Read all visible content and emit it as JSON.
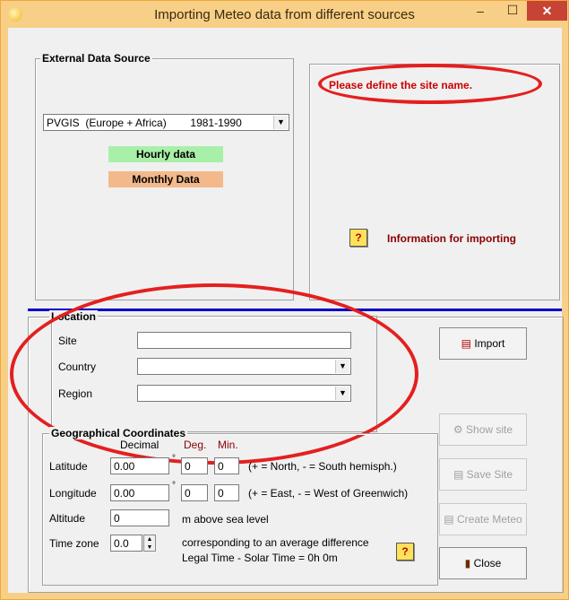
{
  "window": {
    "title": "Importing Meteo data from different sources",
    "minimize": "–",
    "maximize": "☐",
    "close": "✕"
  },
  "external_source": {
    "legend": "External Data Source",
    "source_selected": "PVGIS  (Europe + Africa)        1981-1990",
    "hourly_label": "Hourly data",
    "monthly_label": "Monthly Data"
  },
  "message": {
    "text": "Please define the site name.",
    "info_label": "Information for importing",
    "info_icon": "?"
  },
  "location": {
    "legend": "Location",
    "site_label": "Site",
    "site_value": "",
    "country_label": "Country",
    "country_value": "",
    "region_label": "Region",
    "region_value": ""
  },
  "geo": {
    "legend": "Geographical Coordinates",
    "decimal_header": "Decimal",
    "deg_header": "Deg.",
    "min_header": "Min.",
    "latitude_label": "Latitude",
    "latitude_decimal": "0.00",
    "latitude_deg": "0",
    "latitude_min": "0",
    "latitude_hint": "(+ = North,  - = South hemisph.)",
    "longitude_label": "Longitude",
    "longitude_decimal": "0.00",
    "longitude_deg": "0",
    "longitude_min": "0",
    "longitude_hint": "(+ = East, - = West of Greenwich)",
    "degree_symbol": "°",
    "altitude_label": "Altitude",
    "altitude_value": "0",
    "altitude_unit": "m above sea level",
    "timezone_label": "Time zone",
    "timezone_value": "0.0",
    "timezone_desc_line1": "corresponding to an average difference",
    "timezone_desc_line2": "Legal Time - Solar Time =   0h  0m",
    "help_icon": "?"
  },
  "buttons": {
    "import": "Import",
    "show_site": "Show site",
    "save_site": "Save Site",
    "create_meteo": "Create Meteo",
    "close": "Close"
  },
  "colors": {
    "accent_divider": "#0000cc",
    "hourly_bg": "#a8f0a8",
    "monthly_bg": "#f4b98a",
    "message_text": "#cc0000",
    "highlight_ellipse": "#e41f1f"
  }
}
